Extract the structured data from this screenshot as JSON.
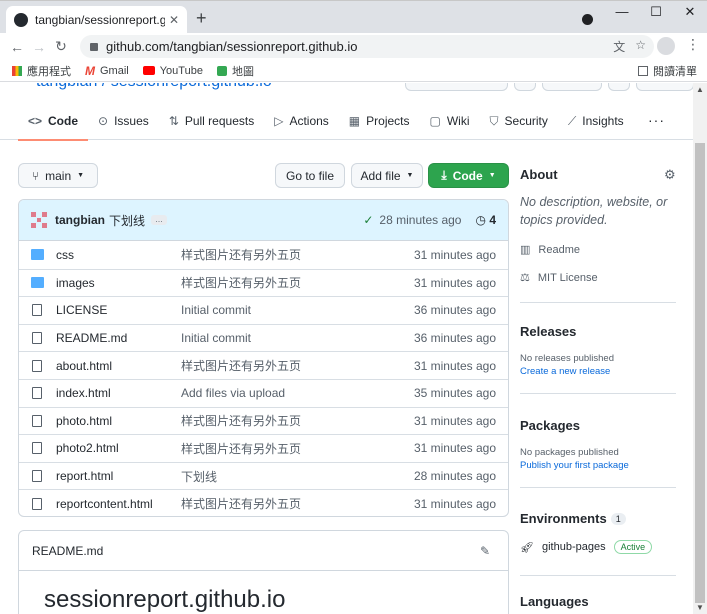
{
  "browser": {
    "tab_title": "tangbian/sessionreport.github.io",
    "url": "github.com/tangbian/sessionreport.github.io",
    "bookmarks": [
      {
        "label": "應用程式",
        "icon": "apps-icon"
      },
      {
        "label": "Gmail",
        "icon": "gmail-icon"
      },
      {
        "label": "YouTube",
        "icon": "youtube-icon"
      },
      {
        "label": "地圖",
        "icon": "maps-icon"
      }
    ],
    "reading_list": "閱讀清單"
  },
  "repo": {
    "header_cut": "tangbian / sessionreport.github.io"
  },
  "nav": {
    "items": [
      {
        "label": "Code",
        "icon": "<>"
      },
      {
        "label": "Issues",
        "icon": "⊙"
      },
      {
        "label": "Pull requests",
        "icon": "⇅"
      },
      {
        "label": "Actions",
        "icon": "▷"
      },
      {
        "label": "Projects",
        "icon": "▦"
      },
      {
        "label": "Wiki",
        "icon": "▢"
      },
      {
        "label": "Security",
        "icon": "⛉"
      },
      {
        "label": "Insights",
        "icon": "⟋"
      }
    ],
    "more": "···"
  },
  "toolbar": {
    "branch": "main",
    "goto_file": "Go to file",
    "add_file": "Add file",
    "code": "Code"
  },
  "commit": {
    "user": "tangbian",
    "message": "下划线",
    "ellipsis": "…",
    "time": "28 minutes ago",
    "history_count": "4"
  },
  "files": [
    {
      "type": "folder",
      "name": "css",
      "message": "样式图片还有另外五页",
      "time": "31 minutes ago"
    },
    {
      "type": "folder",
      "name": "images",
      "message": "样式图片还有另外五页",
      "time": "31 minutes ago"
    },
    {
      "type": "file",
      "name": "LICENSE",
      "message": "Initial commit",
      "time": "36 minutes ago"
    },
    {
      "type": "file",
      "name": "README.md",
      "message": "Initial commit",
      "time": "36 minutes ago"
    },
    {
      "type": "file",
      "name": "about.html",
      "message": "样式图片还有另外五页",
      "time": "31 minutes ago"
    },
    {
      "type": "file",
      "name": "index.html",
      "message": "Add files via upload",
      "time": "35 minutes ago"
    },
    {
      "type": "file",
      "name": "photo.html",
      "message": "样式图片还有另外五页",
      "time": "31 minutes ago"
    },
    {
      "type": "file",
      "name": "photo2.html",
      "message": "样式图片还有另外五页",
      "time": "31 minutes ago"
    },
    {
      "type": "file",
      "name": "report.html",
      "message": "下划线",
      "time": "28 minutes ago"
    },
    {
      "type": "file",
      "name": "reportcontent.html",
      "message": "样式图片还有另外五页",
      "time": "31 minutes ago"
    }
  ],
  "readme": {
    "filename": "README.md",
    "title": "sessionreport.github.io"
  },
  "sidebar": {
    "about_heading": "About",
    "about_desc": "No description, website, or topics provided.",
    "readme_link": "Readme",
    "license_link": "MIT License",
    "releases_heading": "Releases",
    "releases_none": "No releases published",
    "releases_create": "Create a new release",
    "packages_heading": "Packages",
    "packages_none": "No packages published",
    "packages_publish": "Publish your first package",
    "env_heading": "Environments",
    "env_count": "1",
    "env_name": "github-pages",
    "env_status": "Active",
    "languages_heading": "Languages"
  }
}
